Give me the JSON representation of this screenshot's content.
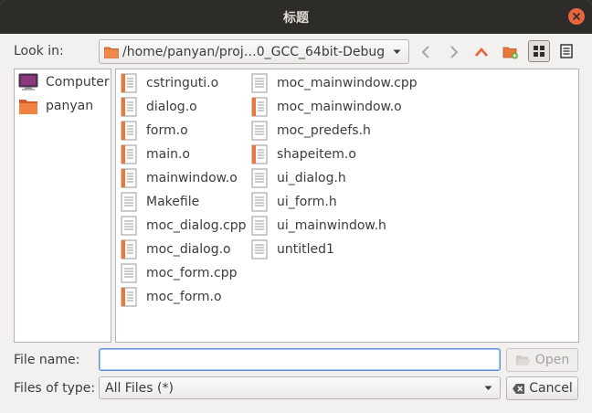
{
  "window": {
    "title": "标题"
  },
  "lookin": {
    "label": "Look in:",
    "path": "/home/panyan/proj…0_GCC_64bit-Debug",
    "icons": [
      "back-icon",
      "forward-icon",
      "parent-directory-icon",
      "new-folder-icon",
      "detail-view-icon",
      "list-view-icon"
    ]
  },
  "sidebar": {
    "items": [
      {
        "label": "Computer",
        "icon": "computer-icon"
      },
      {
        "label": "panyan",
        "icon": "folder-icon"
      }
    ]
  },
  "files": {
    "column1": [
      {
        "name": "cstringuti.o",
        "icon": "binary-file-icon"
      },
      {
        "name": "dialog.o",
        "icon": "binary-file-icon"
      },
      {
        "name": "form.o",
        "icon": "binary-file-icon"
      },
      {
        "name": "main.o",
        "icon": "binary-file-icon"
      },
      {
        "name": "mainwindow.o",
        "icon": "binary-file-icon"
      },
      {
        "name": "Makefile",
        "icon": "text-file-icon"
      },
      {
        "name": "moc_dialog.cpp",
        "icon": "text-file-icon"
      },
      {
        "name": "moc_dialog.o",
        "icon": "binary-file-icon"
      },
      {
        "name": "moc_form.cpp",
        "icon": "text-file-icon"
      },
      {
        "name": "moc_form.o",
        "icon": "binary-file-icon"
      }
    ],
    "column2": [
      {
        "name": "moc_mainwindow.cpp",
        "icon": "text-file-icon"
      },
      {
        "name": "moc_mainwindow.o",
        "icon": "binary-file-icon"
      },
      {
        "name": "moc_predefs.h",
        "icon": "text-file-icon"
      },
      {
        "name": "shapeitem.o",
        "icon": "binary-file-icon"
      },
      {
        "name": "ui_dialog.h",
        "icon": "text-file-icon"
      },
      {
        "name": "ui_form.h",
        "icon": "text-file-icon"
      },
      {
        "name": "ui_mainwindow.h",
        "icon": "text-file-icon"
      },
      {
        "name": "untitled1",
        "icon": "text-file-icon"
      }
    ]
  },
  "filename": {
    "label": "File name:",
    "value": "",
    "placeholder": ""
  },
  "filetype": {
    "label": "Files of type:",
    "selected": "All Files (*)"
  },
  "buttons": {
    "open": "Open",
    "cancel": "Cancel"
  },
  "colors": {
    "accent": "#e9653f",
    "focus": "#5b8fd0",
    "folder": "#e9763a"
  }
}
